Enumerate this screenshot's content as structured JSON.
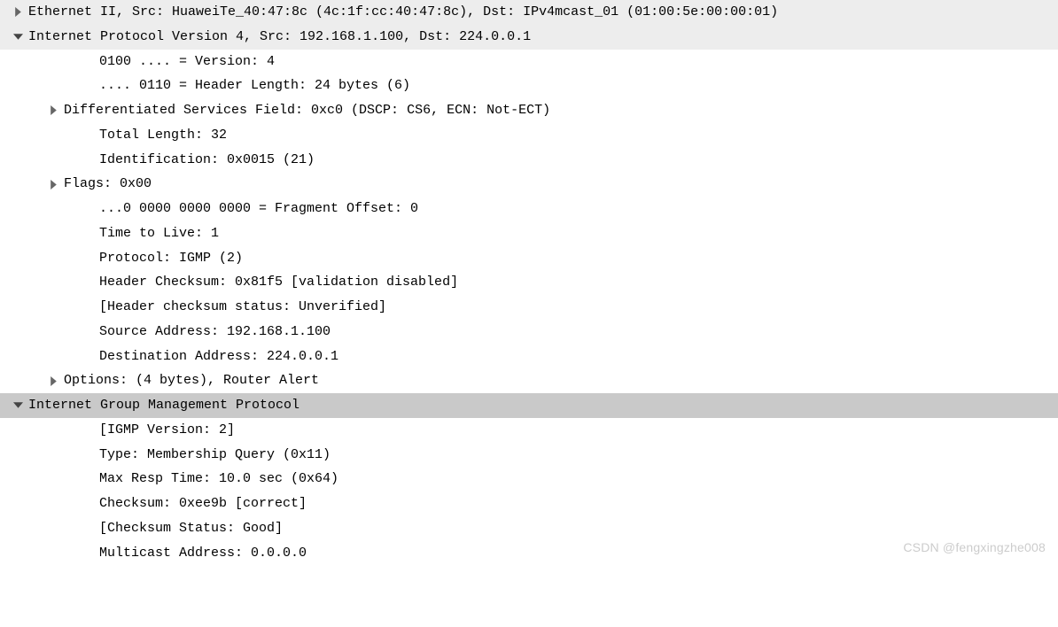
{
  "rows": [
    {
      "indent": 0,
      "arrow": "right",
      "highlighted": true,
      "selected": false,
      "text": "Ethernet II, Src: HuaweiTe_40:47:8c (4c:1f:cc:40:47:8c), Dst: IPv4mcast_01 (01:00:5e:00:00:01)"
    },
    {
      "indent": 0,
      "arrow": "down",
      "highlighted": true,
      "selected": false,
      "text": "Internet Protocol Version 4, Src: 192.168.1.100, Dst: 224.0.0.1"
    },
    {
      "indent": 2,
      "arrow": "none",
      "highlighted": false,
      "selected": false,
      "text": "0100 .... = Version: 4"
    },
    {
      "indent": 2,
      "arrow": "none",
      "highlighted": false,
      "selected": false,
      "text": ".... 0110 = Header Length: 24 bytes (6)"
    },
    {
      "indent": 1,
      "arrow": "right",
      "highlighted": false,
      "selected": false,
      "text": "Differentiated Services Field: 0xc0 (DSCP: CS6, ECN: Not-ECT)"
    },
    {
      "indent": 2,
      "arrow": "none",
      "highlighted": false,
      "selected": false,
      "text": "Total Length: 32"
    },
    {
      "indent": 2,
      "arrow": "none",
      "highlighted": false,
      "selected": false,
      "text": "Identification: 0x0015 (21)"
    },
    {
      "indent": 1,
      "arrow": "right",
      "highlighted": false,
      "selected": false,
      "text": "Flags: 0x00"
    },
    {
      "indent": 2,
      "arrow": "none",
      "highlighted": false,
      "selected": false,
      "text": "...0 0000 0000 0000 = Fragment Offset: 0"
    },
    {
      "indent": 2,
      "arrow": "none",
      "highlighted": false,
      "selected": false,
      "text": "Time to Live: 1"
    },
    {
      "indent": 2,
      "arrow": "none",
      "highlighted": false,
      "selected": false,
      "text": "Protocol: IGMP (2)"
    },
    {
      "indent": 2,
      "arrow": "none",
      "highlighted": false,
      "selected": false,
      "text": "Header Checksum: 0x81f5 [validation disabled]"
    },
    {
      "indent": 2,
      "arrow": "none",
      "highlighted": false,
      "selected": false,
      "text": "[Header checksum status: Unverified]"
    },
    {
      "indent": 2,
      "arrow": "none",
      "highlighted": false,
      "selected": false,
      "text": "Source Address: 192.168.1.100"
    },
    {
      "indent": 2,
      "arrow": "none",
      "highlighted": false,
      "selected": false,
      "text": "Destination Address: 224.0.0.1"
    },
    {
      "indent": 1,
      "arrow": "right",
      "highlighted": false,
      "selected": false,
      "text": "Options: (4 bytes), Router Alert"
    },
    {
      "indent": 0,
      "arrow": "down",
      "highlighted": false,
      "selected": true,
      "text": "Internet Group Management Protocol"
    },
    {
      "indent": 2,
      "arrow": "none",
      "highlighted": false,
      "selected": false,
      "text": "[IGMP Version: 2]"
    },
    {
      "indent": 2,
      "arrow": "none",
      "highlighted": false,
      "selected": false,
      "text": "Type: Membership Query (0x11)"
    },
    {
      "indent": 2,
      "arrow": "none",
      "highlighted": false,
      "selected": false,
      "text": "Max Resp Time: 10.0 sec (0x64)"
    },
    {
      "indent": 2,
      "arrow": "none",
      "highlighted": false,
      "selected": false,
      "text": "Checksum: 0xee9b [correct]"
    },
    {
      "indent": 2,
      "arrow": "none",
      "highlighted": false,
      "selected": false,
      "text": "[Checksum Status: Good]"
    },
    {
      "indent": 2,
      "arrow": "none",
      "highlighted": false,
      "selected": false,
      "text": "Multicast Address: 0.0.0.0"
    }
  ],
  "watermark": "CSDN @fengxingzhe008"
}
